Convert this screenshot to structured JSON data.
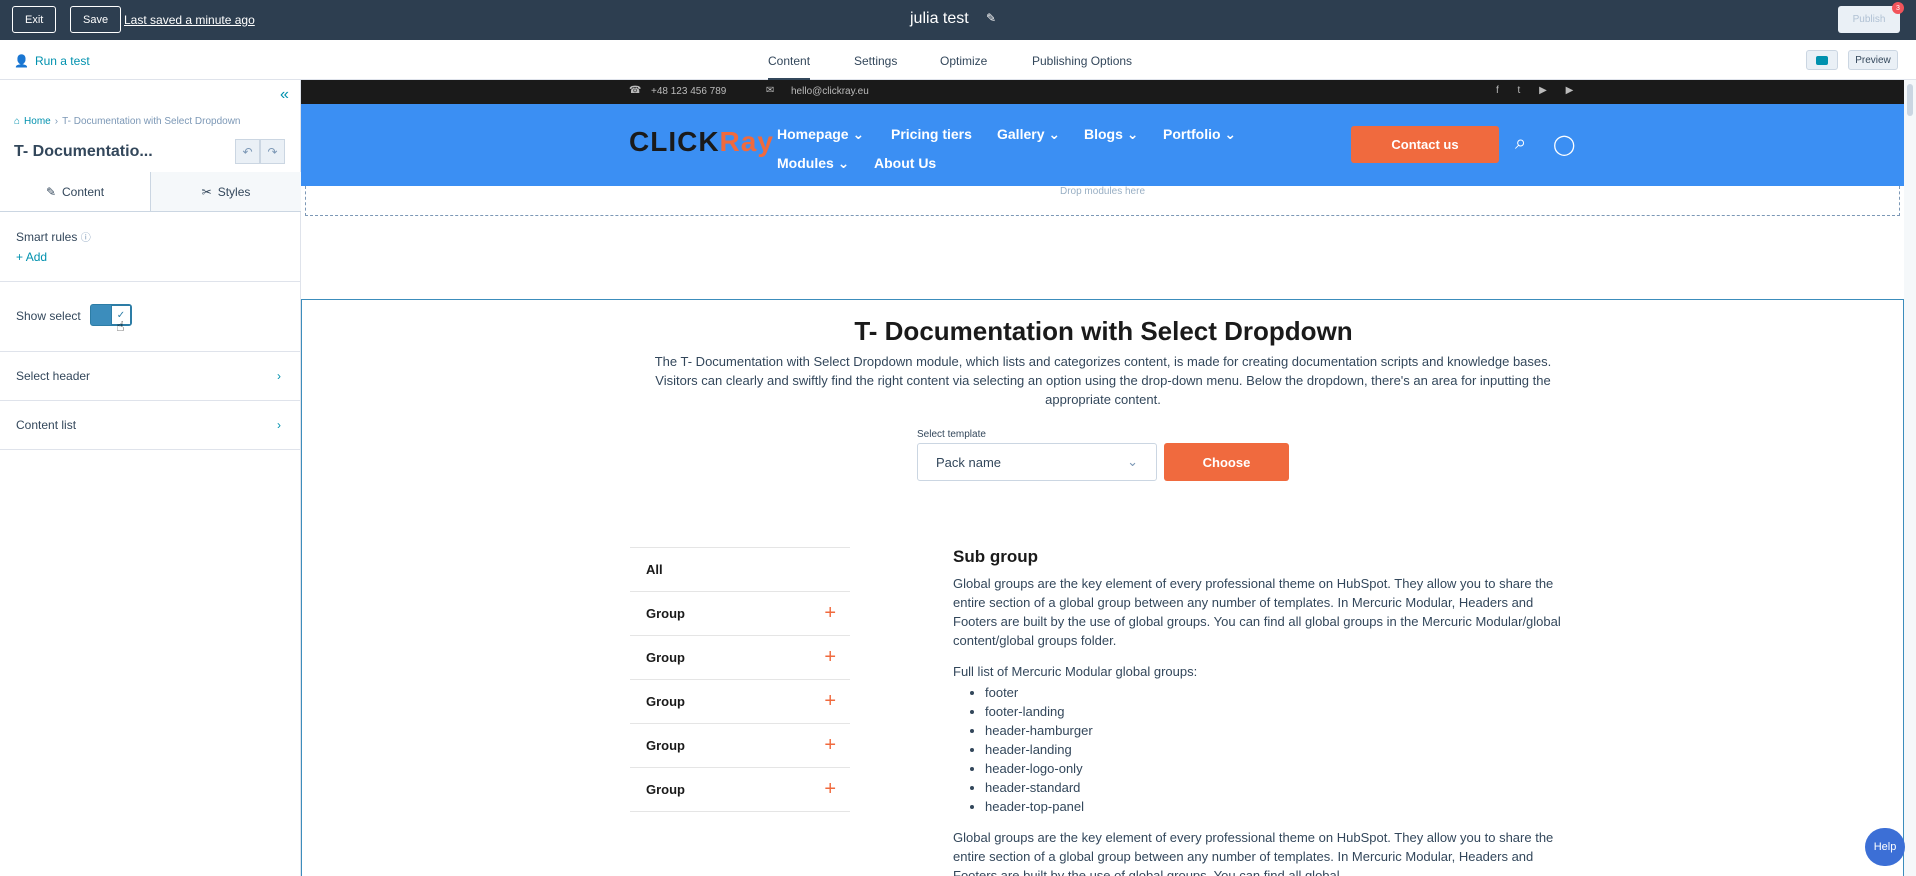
{
  "topbar": {
    "exit_label": "Exit",
    "save_label": "Save",
    "last_saved": "Last saved a minute ago",
    "page_name": "julia test",
    "publish_label": "Publish",
    "notification_count": "3"
  },
  "subbar": {
    "run_test": "Run a test",
    "tabs": [
      {
        "label": "Content",
        "active": true
      },
      {
        "label": "Settings",
        "active": false
      },
      {
        "label": "Optimize",
        "active": false
      },
      {
        "label": "Publishing Options",
        "active": false
      }
    ],
    "preview_label": "Preview"
  },
  "leftpanel": {
    "breadcrumb_home": "Home",
    "breadcrumb_current": "T- Documentation with Select Dropdown",
    "title": "T- Documentatio...",
    "tab_content": "Content",
    "tab_styles": "Styles",
    "smart_rules": "Smart rules",
    "add": "Add",
    "show_select": "Show select",
    "show_select_on": true,
    "select_header": "Select header",
    "content_list": "Content list"
  },
  "site": {
    "phone": "+48 123 456 789",
    "email": "hello@clickray.eu",
    "logo_left": "CLICK",
    "logo_right": "Ray",
    "nav": [
      "Homepage",
      "Pricing tiers",
      "Gallery",
      "Blogs",
      "Portfolio",
      "Modules",
      "About Us"
    ],
    "contact": "Contact us",
    "drop_modules": "Drop modules here"
  },
  "module": {
    "title": "T- Documentation with Select Dropdown",
    "description": "The T- Documentation with Select Dropdown module, which lists and categorizes content, is made for creating documentation scripts and knowledge bases. Visitors can clearly and swiftly find the right content via selecting an option using the drop-down menu. Below the dropdown, there's an area for inputting the appropriate content.",
    "select_label": "Select template",
    "select_value": "Pack name",
    "choose": "Choose",
    "groups": [
      "All",
      "Group",
      "Group",
      "Group",
      "Group",
      "Group"
    ],
    "sub_heading": "Sub group",
    "para1": "Global groups are the key element of every professional theme on HubSpot. They allow you to share the entire section of a global group between any number of templates. In Mercuric Modular, Headers and Footers are built by the use of global groups. You can find all global groups in the Mercuric Modular/global content/global groups folder.",
    "list_intro": "Full list of Mercuric Modular global groups:",
    "list_items": [
      "footer",
      "footer-landing",
      "header-hamburger",
      "header-landing",
      "header-logo-only",
      "header-standard",
      "header-top-panel"
    ],
    "para2": "Global groups are the key element of every professional theme on HubSpot. They allow you to share the entire section of a global group between any number of templates. In Mercuric Modular, Headers and Footers are built by the use of global groups. You can find all global"
  },
  "help_label": "Help",
  "colors": {
    "topbar": "#2d3e50",
    "accent": "#0091ae",
    "site_nav": "#3b8ff3",
    "orange": "#f06a3e"
  }
}
